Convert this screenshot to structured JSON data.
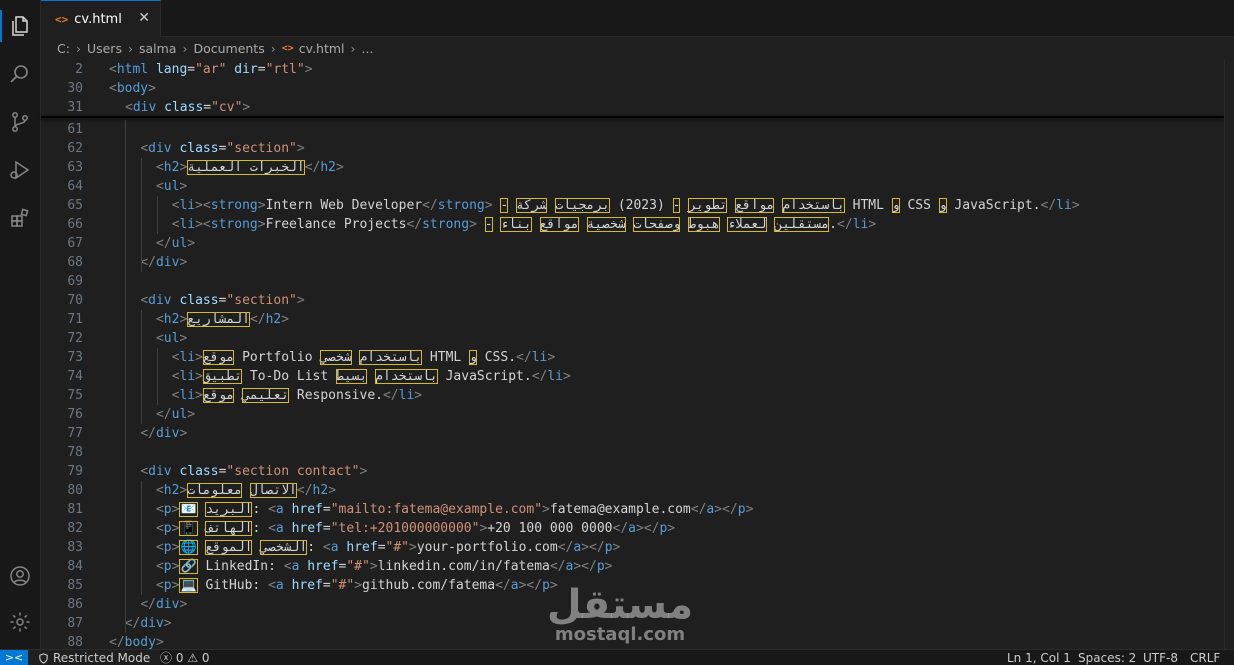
{
  "tab": {
    "filename": "cv.html",
    "icon": "html-icon",
    "close_glyph": "✕"
  },
  "breadcrumb": [
    "C:",
    "Users",
    "salma",
    "Documents",
    "cv.html",
    "..."
  ],
  "sticky": [
    {
      "n": "2",
      "indent": 0,
      "html": "<span class='t'>&lt;</span><span class='tg'>html</span> <span class='at'>lang</span><span class='tx'>=</span><span class='st'>\"ar\"</span> <span class='at'>dir</span><span class='tx'>=</span><span class='st'>\"rtl\"</span><span class='t'>&gt;</span>"
    },
    {
      "n": "30",
      "indent": 0,
      "html": "<span class='t'>&lt;</span><span class='tg'>body</span><span class='t'>&gt;</span>"
    },
    {
      "n": "31",
      "indent": 2,
      "html": "<span class='t'>&lt;</span><span class='tg'>div</span> <span class='at'>class</span><span class='tx'>=</span><span class='st'>\"cv\"</span><span class='t'>&gt;</span>"
    }
  ],
  "lines": [
    {
      "n": "61",
      "html": ""
    },
    {
      "n": "62",
      "html": "    <span class='t'>&lt;</span><span class='tg'>div</span> <span class='at'>class</span><span class='tx'>=</span><span class='st'>\"section\"</span><span class='t'>&gt;</span>"
    },
    {
      "n": "63",
      "html": "      <span class='t'>&lt;</span><span class='tg'>h2</span><span class='t'>&gt;</span><span class='uc'>الخبرات العملية</span><span class='t'>&lt;/</span><span class='tg'>h2</span><span class='t'>&gt;</span>"
    },
    {
      "n": "64",
      "html": "      <span class='t'>&lt;</span><span class='tg'>ul</span><span class='t'>&gt;</span>"
    },
    {
      "n": "65",
      "html": "        <span class='t'>&lt;</span><span class='tg'>li</span><span class='t'>&gt;&lt;</span><span class='tg'>strong</span><span class='t'>&gt;</span><span class='tx'>Intern Web Developer</span><span class='t'>&lt;/</span><span class='tg'>strong</span><span class='t'>&gt;</span> <span class='uc'>-</span> <span class='uc'>باستخدام</span> <span class='uc'>مواقع</span> <span class='uc'>تطوير</span> <span class='uc'>-</span> <span class='tx'>(2023)</span> <span class='uc'>برمجيات</span> <span class='uc'>شركة</span><span class='tx'> HTML </span><span class='uc'>و</span><span class='tx'> CSS </span><span class='uc'>و</span><span class='tx'> JavaScript.</span><span class='t'>&lt;/</span><span class='tg'>li</span><span class='t'>&gt;</span>"
    },
    {
      "n": "66",
      "html": "        <span class='t'>&lt;</span><span class='tg'>li</span><span class='t'>&gt;&lt;</span><span class='tg'>strong</span><span class='t'>&gt;</span><span class='tx'>Freelance Projects</span><span class='t'>&lt;/</span><span class='tg'>strong</span><span class='t'>&gt;</span> <span class='uc'>-</span> <span class='uc'>مستقلين</span> <span class='uc'>لعملاء</span> <span class='uc'>هبوط</span> <span class='uc'>وصفحات</span> <span class='uc'>شخصية</span> <span class='uc'>مواقع</span> <span class='uc'>بناء</span><span class='tx'>.</span><span class='t'>&lt;/</span><span class='tg'>li</span><span class='t'>&gt;</span>"
    },
    {
      "n": "67",
      "html": "      <span class='t'>&lt;/</span><span class='tg'>ul</span><span class='t'>&gt;</span>"
    },
    {
      "n": "68",
      "html": "    <span class='t'>&lt;/</span><span class='tg'>div</span><span class='t'>&gt;</span>"
    },
    {
      "n": "69",
      "html": ""
    },
    {
      "n": "70",
      "html": "    <span class='t'>&lt;</span><span class='tg'>div</span> <span class='at'>class</span><span class='tx'>=</span><span class='st'>\"section\"</span><span class='t'>&gt;</span>"
    },
    {
      "n": "71",
      "html": "      <span class='t'>&lt;</span><span class='tg'>h2</span><span class='t'>&gt;</span><span class='uc'>المشاريع</span><span class='t'>&lt;/</span><span class='tg'>h2</span><span class='t'>&gt;</span>"
    },
    {
      "n": "72",
      "html": "      <span class='t'>&lt;</span><span class='tg'>ul</span><span class='t'>&gt;</span>"
    },
    {
      "n": "73",
      "html": "        <span class='t'>&lt;</span><span class='tg'>li</span><span class='t'>&gt;</span><span class='uc'>موقع</span><span class='tx'> Portfolio </span><span class='uc'>باستخدام</span> <span class='uc'>شخصي</span><span class='tx'> HTML </span><span class='uc'>و</span><span class='tx'> CSS.</span><span class='t'>&lt;/</span><span class='tg'>li</span><span class='t'>&gt;</span>"
    },
    {
      "n": "74",
      "html": "        <span class='t'>&lt;</span><span class='tg'>li</span><span class='t'>&gt;</span><span class='uc'>تطبيق</span><span class='tx'> To-Do List </span><span class='uc'>باستخدام</span> <span class='uc'>بسيط</span><span class='tx'> JavaScript.</span><span class='t'>&lt;/</span><span class='tg'>li</span><span class='t'>&gt;</span>"
    },
    {
      "n": "75",
      "html": "        <span class='t'>&lt;</span><span class='tg'>li</span><span class='t'>&gt;</span><span class='uc'>تعليمي</span> <span class='uc'>موقع</span><span class='tx'> Responsive.</span><span class='t'>&lt;/</span><span class='tg'>li</span><span class='t'>&gt;</span>"
    },
    {
      "n": "76",
      "html": "      <span class='t'>&lt;/</span><span class='tg'>ul</span><span class='t'>&gt;</span>"
    },
    {
      "n": "77",
      "html": "    <span class='t'>&lt;/</span><span class='tg'>div</span><span class='t'>&gt;</span>"
    },
    {
      "n": "78",
      "html": ""
    },
    {
      "n": "79",
      "html": "    <span class='t'>&lt;</span><span class='tg'>div</span> <span class='at'>class</span><span class='tx'>=</span><span class='st'>\"section contact\"</span><span class='t'>&gt;</span>"
    },
    {
      "n": "80",
      "html": "      <span class='t'>&lt;</span><span class='tg'>h2</span><span class='t'>&gt;</span><span class='uc'>الاتصال</span> <span class='uc'>معلومات</span><span class='t'>&lt;/</span><span class='tg'>h2</span><span class='t'>&gt;</span>"
    },
    {
      "n": "81",
      "html": "      <span class='t'>&lt;</span><span class='tg'>p</span><span class='t'>&gt;</span><span class='emo'>📧</span> <span class='uc'>البريد</span><span class='tx'>: </span><span class='t'>&lt;</span><span class='tg'>a</span> <span class='at'>href</span><span class='tx'>=</span><span class='st'>\"mailto:fatema@example.com\"</span><span class='t'>&gt;</span><span class='tx'>fatema@example.com</span><span class='t'>&lt;/</span><span class='tg'>a</span><span class='t'>&gt;&lt;/</span><span class='tg'>p</span><span class='t'>&gt;</span>"
    },
    {
      "n": "82",
      "html": "      <span class='t'>&lt;</span><span class='tg'>p</span><span class='t'>&gt;</span><span class='emo'>📱</span> <span class='uc'>الهاتف</span><span class='tx'>: </span><span class='t'>&lt;</span><span class='tg'>a</span> <span class='at'>href</span><span class='tx'>=</span><span class='st'>\"tel:+201000000000\"</span><span class='t'>&gt;</span><span class='tx'>+20 100 000 0000</span><span class='t'>&lt;/</span><span class='tg'>a</span><span class='t'>&gt;&lt;/</span><span class='tg'>p</span><span class='t'>&gt;</span>"
    },
    {
      "n": "83",
      "html": "      <span class='t'>&lt;</span><span class='tg'>p</span><span class='t'>&gt;</span><span class='emo'>🌐</span> <span class='uc'>الشخصي</span> <span class='uc'>الموقع</span><span class='tx'>: </span><span class='t'>&lt;</span><span class='tg'>a</span> <span class='at'>href</span><span class='tx'>=</span><span class='st'>\"#\"</span><span class='t'>&gt;</span><span class='tx'>your-portfolio.com</span><span class='t'>&lt;/</span><span class='tg'>a</span><span class='t'>&gt;&lt;/</span><span class='tg'>p</span><span class='t'>&gt;</span>"
    },
    {
      "n": "84",
      "html": "      <span class='t'>&lt;</span><span class='tg'>p</span><span class='t'>&gt;</span><span class='emo'>🔗</span><span class='tx'> LinkedIn: </span><span class='t'>&lt;</span><span class='tg'>a</span> <span class='at'>href</span><span class='tx'>=</span><span class='st'>\"#\"</span><span class='t'>&gt;</span><span class='tx'>linkedin.com/in/fatema</span><span class='t'>&lt;/</span><span class='tg'>a</span><span class='t'>&gt;&lt;/</span><span class='tg'>p</span><span class='t'>&gt;</span>"
    },
    {
      "n": "85",
      "html": "      <span class='t'>&lt;</span><span class='tg'>p</span><span class='t'>&gt;</span><span class='emo'>💻</span><span class='tx'> GitHub: </span><span class='t'>&lt;</span><span class='tg'>a</span> <span class='at'>href</span><span class='tx'>=</span><span class='st'>\"#\"</span><span class='t'>&gt;</span><span class='tx'>github.com/fatema</span><span class='t'>&lt;/</span><span class='tg'>a</span><span class='t'>&gt;&lt;/</span><span class='tg'>p</span><span class='t'>&gt;</span>"
    },
    {
      "n": "86",
      "html": "    <span class='t'>&lt;/</span><span class='tg'>div</span><span class='t'>&gt;</span>"
    },
    {
      "n": "87",
      "html": "  <span class='t'>&lt;/</span><span class='tg'>div</span><span class='t'>&gt;</span>"
    },
    {
      "n": "88",
      "html": "<span class='t'>&lt;/</span><span class='tg'>body</span><span class='t'>&gt;</span>"
    }
  ],
  "watermark": {
    "arabic": "مستقل",
    "latin": "mostaql.com"
  },
  "status": {
    "remote_glyph": "><",
    "restricted": "Restricted Mode",
    "errors": "0",
    "warnings": "0",
    "position": "Ln 1, Col 1",
    "spaces": "Spaces: 2",
    "encoding": "UTF-8",
    "eol": "CRLF"
  },
  "colors": {
    "accent": "#0078d4",
    "tag": "#569cd6",
    "attr": "#9cdcfe",
    "string": "#ce9178",
    "unicode_highlight": "#d7ba2a"
  }
}
